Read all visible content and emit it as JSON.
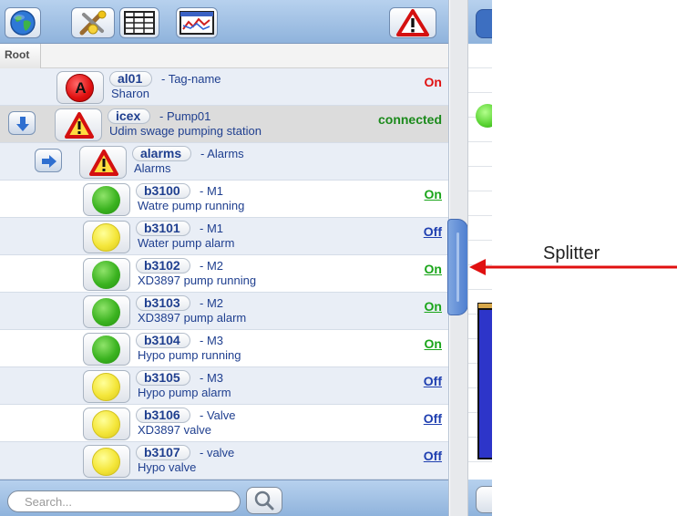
{
  "toolbar": {
    "buttons": [
      {
        "name": "globe-icon"
      },
      {
        "name": "tools-icon"
      },
      {
        "name": "table-icon"
      },
      {
        "name": "chart-icon"
      },
      {
        "name": "alarm-warning-icon"
      }
    ]
  },
  "breadcrumb": {
    "root": "Root"
  },
  "tags": [
    {
      "tag": "al01",
      "name": "- Tag-name",
      "desc": "Sharon",
      "value": "On",
      "value_color": "#e01010",
      "link": false,
      "indicator": "red",
      "indicator_letter": "A"
    },
    {
      "tag": "icex",
      "name": "- Pump01",
      "desc": "Udim swage pumping station",
      "value": "connected",
      "value_color": "#1b8a1b",
      "link": false,
      "indicator": "warning",
      "nav": "down"
    },
    {
      "tag": "alarms",
      "name": "- Alarms",
      "desc": "Alarms",
      "value": "",
      "value_color": "#1b8a1b",
      "link": false,
      "indicator": "warning",
      "nav": "right"
    },
    {
      "tag": "b3100",
      "name": "- M1",
      "desc": "Watre pump running",
      "value": "On",
      "value_color": "#1aa51a",
      "link": true,
      "indicator": "green"
    },
    {
      "tag": "b3101",
      "name": "- M1",
      "desc": "Water pump alarm",
      "value": "Off",
      "value_color": "#1f3fb0",
      "link": true,
      "indicator": "yellow"
    },
    {
      "tag": "b3102",
      "name": "- M2",
      "desc": "XD3897 pump running",
      "value": "On",
      "value_color": "#1aa51a",
      "link": true,
      "indicator": "green"
    },
    {
      "tag": "b3103",
      "name": "- M2",
      "desc": "XD3897 pump alarm",
      "value": "On",
      "value_color": "#1aa51a",
      "link": true,
      "indicator": "green"
    },
    {
      "tag": "b3104",
      "name": "- M3",
      "desc": "Hypo pump running",
      "value": "On",
      "value_color": "#1aa51a",
      "link": true,
      "indicator": "green"
    },
    {
      "tag": "b3105",
      "name": "- M3",
      "desc": "Hypo pump alarm",
      "value": "Off",
      "value_color": "#1f3fb0",
      "link": true,
      "indicator": "yellow"
    },
    {
      "tag": "b3106",
      "name": "- Valve",
      "desc": "XD3897 valve",
      "value": "Off",
      "value_color": "#1f3fb0",
      "link": true,
      "indicator": "yellow"
    },
    {
      "tag": "b3107",
      "name": "- valve",
      "desc": "Hypo valve",
      "value": "Off",
      "value_color": "#1f3fb0",
      "link": true,
      "indicator": "yellow"
    }
  ],
  "search": {
    "placeholder": "Search...",
    "value": ""
  },
  "annotation": {
    "label": "Splitter",
    "color": "#e01010"
  }
}
